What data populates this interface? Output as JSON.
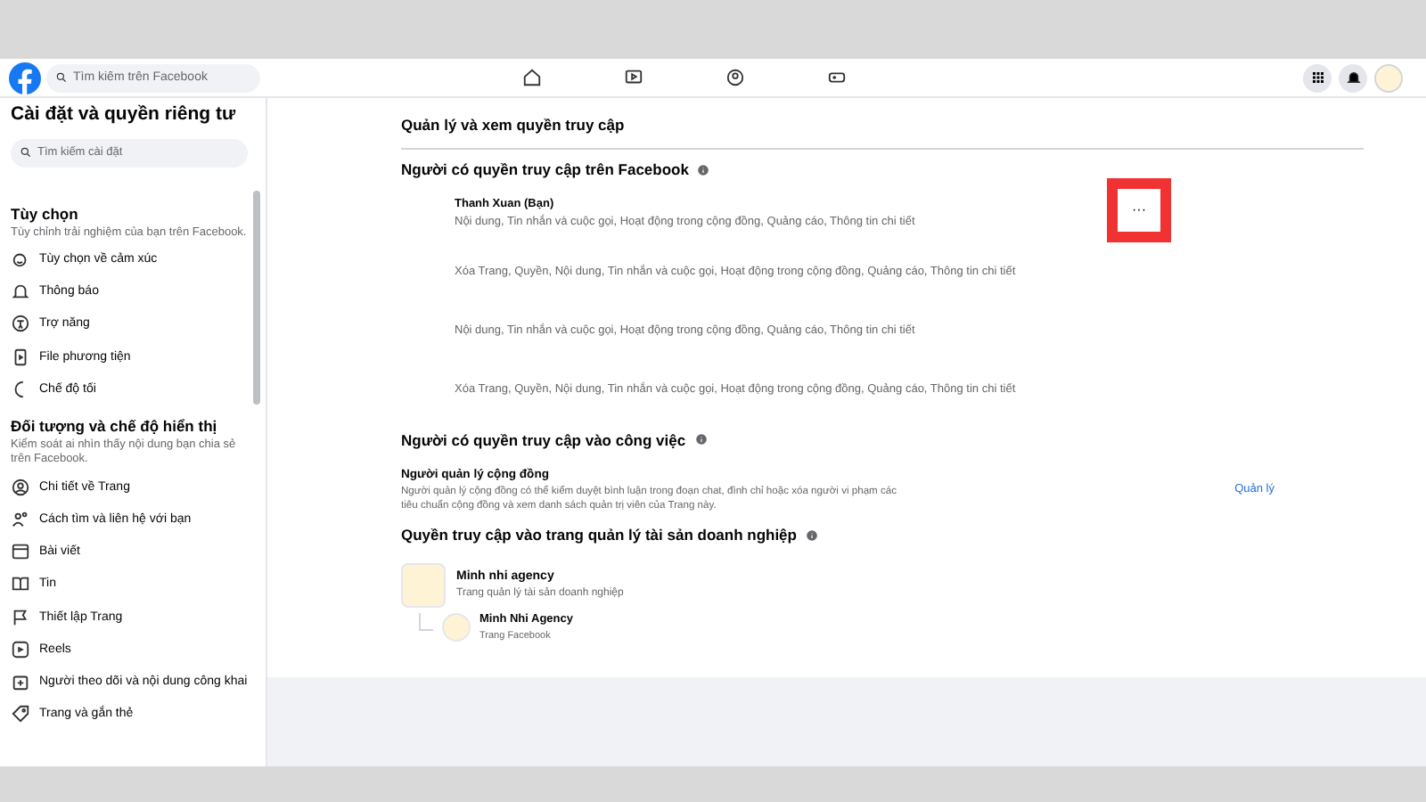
{
  "header": {
    "search": {
      "placeholder": "Tìm kiếm trên Facebook"
    },
    "nav": [
      {
        "selected": false
      },
      {
        "selected": false
      },
      {
        "selected": false
      },
      {
        "selected": false
      }
    ]
  },
  "sidebar": {
    "title": "Cài đặt và quyền riêng tư",
    "search": {
      "placeholder": "Tìm kiếm cài đặt"
    },
    "sections": [
      {
        "title": "Tùy chọn",
        "description": "Tùy chỉnh trải nghiệm của bạn trên Facebook.",
        "items": [
          {
            "label": "Tùy chọn về cảm xúc"
          },
          {
            "label": "Thông báo"
          },
          {
            "label": "Trợ năng"
          },
          {
            "label": "File phương tiện"
          },
          {
            "label": "Chế độ tối"
          }
        ]
      },
      {
        "title": "Đối tượng và chế độ hiển thị",
        "description": "Kiểm soát ai nhìn thấy nội dung bạn chia sẻ trên Facebook.",
        "items": [
          {
            "label": "Chi tiết về Trang"
          },
          {
            "label": "Cách tìm và liên hệ với bạn"
          },
          {
            "label": "Bài viết"
          },
          {
            "label": "Tin"
          },
          {
            "label": "Thiết lập Trang"
          },
          {
            "label": "Reels"
          },
          {
            "label": "Người theo dõi và nội dung công khai"
          },
          {
            "label": "Trang và gắn thẻ"
          }
        ]
      }
    ]
  },
  "main": {
    "title": "Quản lý và xem quyền truy cập",
    "facebook_access": {
      "title": "Người có quyền truy cập trên Facebook",
      "more_button": {
        "label": "···",
        "highlighted": true
      },
      "rows": [
        {
          "name": "Thanh Xuan (Bạn)",
          "permissions": "Nội dung, Tin nhắn và cuộc gọi, Hoạt động trong cộng đồng, Quảng cáo, Thông tin chi tiết"
        },
        {
          "permissions": "Xóa Trang, Quyền, Nội dung, Tin nhắn và cuộc gọi, Hoạt động trong cộng đồng, Quảng cáo, Thông tin chi tiết"
        },
        {
          "permissions": "Nội dung, Tin nhắn và cuộc gọi, Hoạt động trong cộng đồng, Quảng cáo, Thông tin chi tiết"
        },
        {
          "permissions": "Xóa Trang, Quyền, Nội dung, Tin nhắn và cuộc gọi, Hoạt động trong cộng đồng, Quảng cáo, Thông tin chi tiết"
        }
      ]
    },
    "task_access": {
      "title": "Người có quyền truy cập vào công việc",
      "role": "Người quản lý cộng đồng",
      "description": "Người quản lý cộng đồng có thể kiểm duyệt bình luận trong đoạn chat, đình chỉ hoặc xóa người vi phạm các tiêu chuẩn cộng đồng và xem danh sách quản trị viên của Trang này.",
      "link": "Quản lý"
    },
    "business_access": {
      "title": "Quyền truy cập vào trang quản lý tài sản doanh nghiệp",
      "portfolio": {
        "name": "Minh nhi agency",
        "subtitle": "Trang quản lý tài sản doanh nghiệp",
        "children": [
          {
            "name": "Minh Nhi Agency",
            "subtitle": "Trang Facebook"
          }
        ]
      }
    }
  }
}
